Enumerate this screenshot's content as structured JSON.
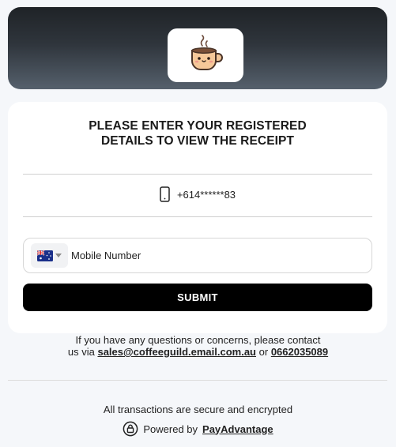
{
  "header": {
    "logo_icon": "coffee-cup-icon"
  },
  "card": {
    "title_line1": "PLEASE ENTER YOUR REGISTERED",
    "title_line2": "DETAILS TO VIEW THE RECEIPT",
    "phone_icon": "mobile-phone-icon",
    "masked_phone": "+614******83",
    "country_flag": "australia-flag-icon",
    "mobile_placeholder": "Mobile Number",
    "submit_label": "SUBMIT"
  },
  "contact": {
    "line1": "If you have any questions or concerns, please contact",
    "prefix": "us via",
    "email": "sales@coffeeguild.email.com.au",
    "or": "or",
    "phone": "0662035089"
  },
  "footer": {
    "secure_text": "All transactions are secure and encrypted",
    "powered_prefix": "Powered by",
    "powered_link": "PayAdvantage",
    "lock_icon": "lock-icon"
  },
  "colors": {
    "accent": "#000000",
    "header_top": "#1f2327",
    "header_bottom": "#55606c"
  }
}
